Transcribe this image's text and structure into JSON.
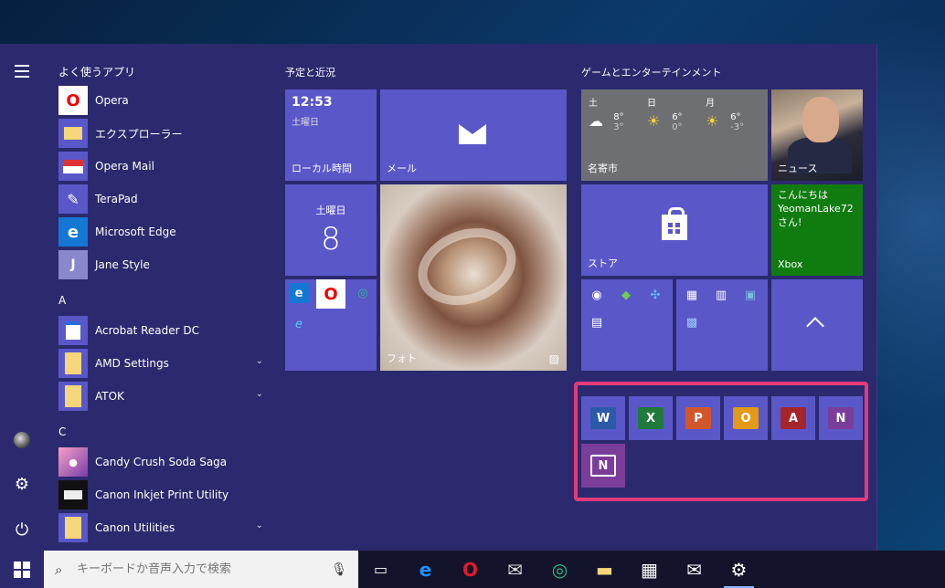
{
  "start_menu": {
    "app_list": {
      "heading": "よく使うアプリ",
      "frequent": [
        {
          "label": "Opera",
          "icon": "opera-icon",
          "color": "#ffffff"
        },
        {
          "label": "エクスプローラー",
          "icon": "folder-icon",
          "color": "#5a57c9"
        },
        {
          "label": "Opera  Mail",
          "icon": "opera-mail-icon",
          "color": "#5a57c9"
        },
        {
          "label": "TeraPad",
          "icon": "terapad-icon",
          "color": "#5a57c9"
        },
        {
          "label": "Microsoft Edge",
          "icon": "edge-icon",
          "color": "#1577d4"
        },
        {
          "label": "Jane Style",
          "icon": "jane-icon",
          "color": "#8888cc"
        }
      ],
      "section_a": "A",
      "a_apps": [
        {
          "label": "Acrobat Reader DC",
          "icon": "acrobat-icon"
        },
        {
          "label": "AMD Settings",
          "icon": "folder-icon",
          "expandable": true
        },
        {
          "label": "ATOK",
          "icon": "folder-icon",
          "expandable": true
        }
      ],
      "section_c": "C",
      "c_apps": [
        {
          "label": "Candy Crush Soda Saga",
          "icon": "candy-crush-icon"
        },
        {
          "label": "Canon Inkjet Print Utility",
          "icon": "printer-icon"
        },
        {
          "label": "Canon Utilities",
          "icon": "folder-icon",
          "expandable": true
        }
      ]
    },
    "groups": {
      "schedule_title": "予定と近況",
      "entertainment_title": "ゲームとエンターテインメント"
    },
    "tiles": {
      "clock": {
        "time": "12:53",
        "day": "土曜日",
        "label": "ローカル時間"
      },
      "mail": {
        "label": "メール"
      },
      "calendar": {
        "day": "土曜日",
        "date": "8"
      },
      "photo": {
        "label": "フォト"
      },
      "weather": {
        "days": [
          {
            "day": "土",
            "high": "8°",
            "low": "3°"
          },
          {
            "day": "日",
            "high": "6°",
            "low": "0°"
          },
          {
            "day": "月",
            "high": "6°",
            "low": "-3°"
          }
        ],
        "label": "名寄市"
      },
      "news": {
        "label": "ニュース"
      },
      "store": {
        "label": "ストア"
      },
      "xbox": {
        "message": "こんにちは YeomanLake72 さん!",
        "label": "Xbox",
        "color": "#107c10"
      }
    }
  },
  "taskbar": {
    "search_placeholder": "キーボードか音声入力で検索"
  },
  "colors": {
    "menu_bg": "#2b2a6e",
    "tile_bg": "#5a57c9",
    "highlight_border": "#e83a7a"
  }
}
